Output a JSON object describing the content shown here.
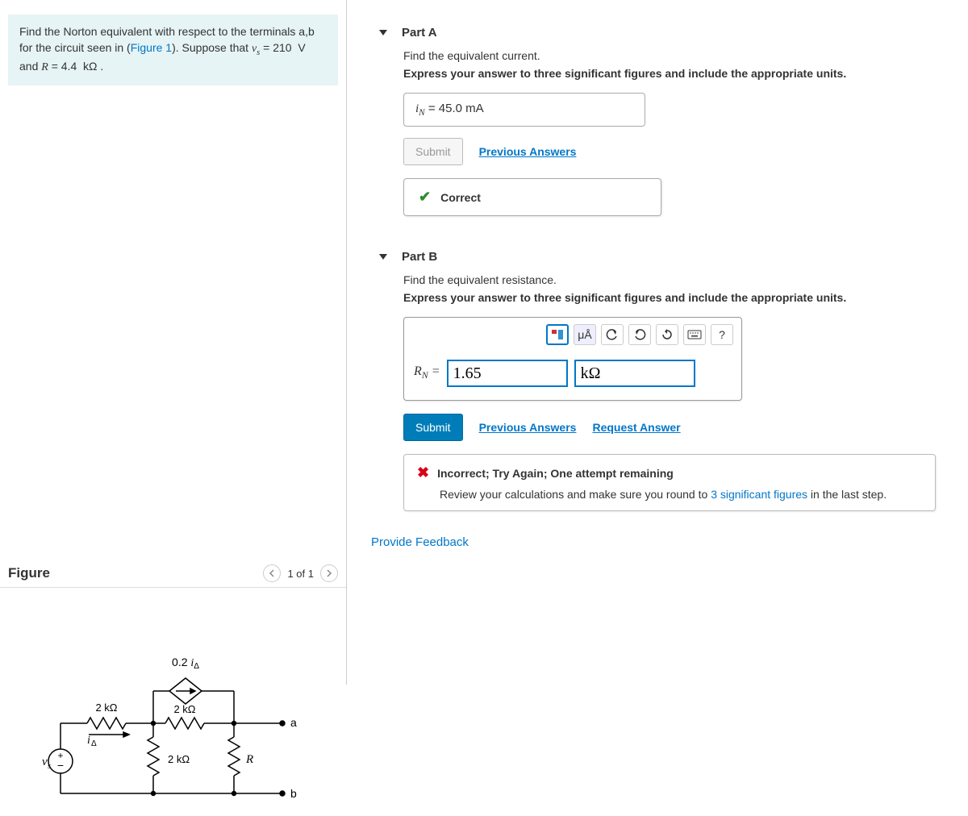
{
  "problem": {
    "intro_a": "Find the Norton equivalent with respect to the terminals a,b for the circuit seen in (",
    "fig_link": "Figure 1",
    "intro_b": "). Suppose that ",
    "vs_var": "v",
    "vs_sub": "s",
    "vs_eq": " = 210  V  and ",
    "r_var": "R",
    "r_eq": " = 4.4  kΩ ."
  },
  "figure": {
    "title": "Figure",
    "counter": "1 of 1",
    "labels": {
      "dep_src": "0.2 ",
      "ia_var": "i",
      "ia_sub": "Δ",
      "r1": "2 kΩ",
      "r2": "2 kΩ",
      "r3": "2 kΩ",
      "r4_var": "R",
      "vs_var": "v",
      "vs_sub": "s",
      "node_a": "a",
      "node_b": "b"
    }
  },
  "partA": {
    "label": "Part A",
    "prompt1": "Find the equivalent current.",
    "prompt2": "Express your answer to three significant figures and include the appropriate units.",
    "ans_var": "i",
    "ans_sub": "N",
    "ans_eq": " = ",
    "ans_val": "45.0 mA",
    "submit": "Submit",
    "prev": "Previous Answers",
    "feedback": "Correct"
  },
  "partB": {
    "label": "Part B",
    "prompt1": "Find the equivalent resistance.",
    "prompt2": "Express your answer to three significant figures and include the appropriate units.",
    "toolbar": {
      "mua": "μÅ",
      "help": "?"
    },
    "ans_var": "R",
    "ans_sub": "N",
    "ans_eq": " = ",
    "value": "1.65",
    "unit": "kΩ",
    "submit": "Submit",
    "prev": "Previous Answers",
    "request": "Request Answer",
    "fb_title": "Incorrect; Try Again; One attempt remaining",
    "fb_review_a": "Review your calculations and make sure you round to ",
    "fb_review_link": "3 significant figures",
    "fb_review_b": " in the last step."
  },
  "footer": {
    "provide": "Provide Feedback"
  }
}
